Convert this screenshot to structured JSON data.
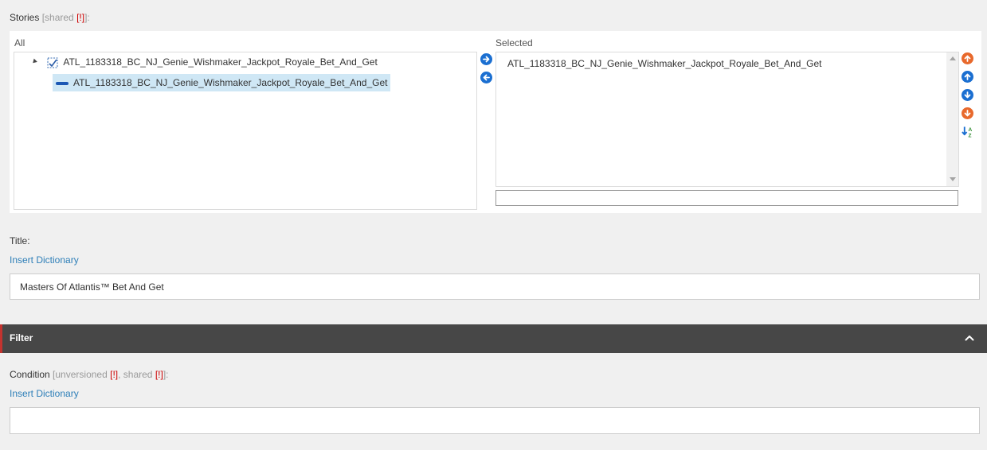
{
  "stories": {
    "label": "Stories",
    "shared_text": "[shared",
    "warn": "[!]",
    "close": "]:"
  },
  "all_panel": {
    "header": "All",
    "root_item": "ATL_1183318_BC_NJ_Genie_Wishmaker_Jackpot_Royale_Bet_And_Get",
    "child_item": "ATL_1183318_BC_NJ_Genie_Wishmaker_Jackpot_Royale_Bet_And_Get"
  },
  "selected_panel": {
    "header": "Selected",
    "items": [
      "ATL_1183318_BC_NJ_Genie_Wishmaker_Jackpot_Royale_Bet_And_Get"
    ],
    "filter_value": ""
  },
  "icons": {
    "move_right": "arrow-right-icon",
    "move_left": "arrow-left-icon",
    "move_top": "move-top-icon",
    "move_up": "move-up-icon",
    "move_down": "move-down-icon",
    "move_bottom": "move-bottom-icon",
    "sort": "sort-az-icon",
    "collapse": "chevron-up-icon"
  },
  "title_field": {
    "label": "Title:",
    "insert_dictionary": "Insert Dictionary",
    "value": "Masters Of Atlantis™ Bet And Get"
  },
  "filter_section": {
    "title": "Filter"
  },
  "condition_field": {
    "label": "Condition",
    "unversioned_text": "[unversioned",
    "warn1": "[!]",
    "sep": ", shared",
    "warn2": "[!]",
    "close": "]:",
    "insert_dictionary": "Insert Dictionary",
    "value": ""
  },
  "colors": {
    "accent_blue": "#1b6fd1",
    "accent_orange": "#e8692c",
    "link": "#2e7fb8",
    "filter_bar": "#474747",
    "filter_accent": "#c4332f",
    "selection": "#cfe7f5"
  }
}
